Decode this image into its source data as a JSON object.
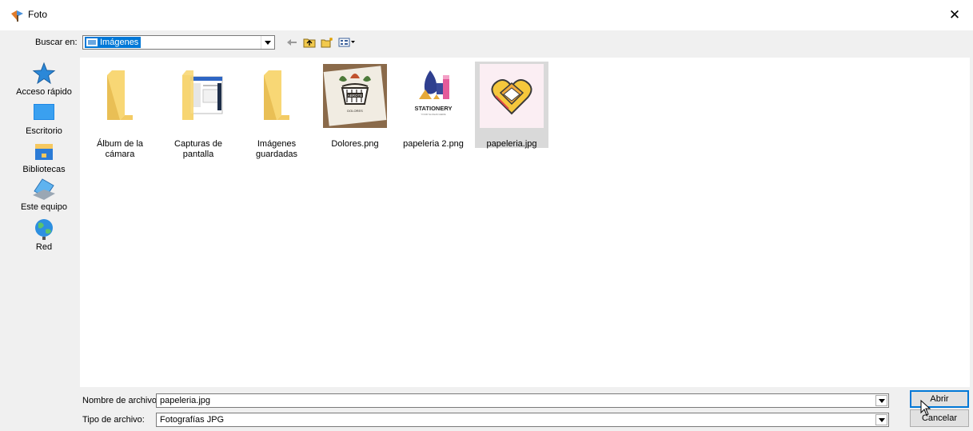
{
  "window": {
    "title": "Foto",
    "close_glyph": "✕"
  },
  "lookin": {
    "label": "Buscar en:",
    "value": "Imágenes"
  },
  "toolbar": [
    {
      "icon": "back-arrow-icon"
    },
    {
      "icon": "up-folder-icon"
    },
    {
      "icon": "new-folder-icon"
    },
    {
      "icon": "view-menu-icon"
    }
  ],
  "places": [
    {
      "label": "Acceso rápido",
      "icon": "star-icon"
    },
    {
      "label": "Escritorio",
      "icon": "desktop-icon"
    },
    {
      "label": "Bibliotecas",
      "icon": "libraries-icon"
    },
    {
      "label": "Este equipo",
      "icon": "computer-icon"
    },
    {
      "label": "Red",
      "icon": "network-icon"
    }
  ],
  "files": [
    {
      "line1": "Álbum de la",
      "line2": "cámara",
      "type": "folder"
    },
    {
      "line1": "Capturas de",
      "line2": "pantalla",
      "type": "folder-screenshot"
    },
    {
      "line1": "Imágenes",
      "line2": "guardadas",
      "type": "folder"
    },
    {
      "line1": "Dolores.png",
      "line2": "",
      "type": "image",
      "logo_text": "ABROTE",
      "logo_sub": "DOLORES"
    },
    {
      "line1": "papeleria 2.png",
      "line2": "",
      "type": "image",
      "logo_text": "STATIONERY",
      "logo_sub": "YOUR SLOGAN HERE"
    },
    {
      "line1": "papeleria.jpg",
      "line2": "",
      "type": "image",
      "selected": true
    }
  ],
  "filename": {
    "label": "Nombre de archivo:",
    "value": "papeleria.jpg"
  },
  "filetype": {
    "label": "Tipo de archivo:",
    "value": "Fotografías JPG"
  },
  "buttons": {
    "open": "Abrir",
    "cancel": "Cancelar"
  },
  "colors": {
    "selection": "#0078d7",
    "folder": "#f8d775",
    "item_selected": "#d9d9d9"
  }
}
